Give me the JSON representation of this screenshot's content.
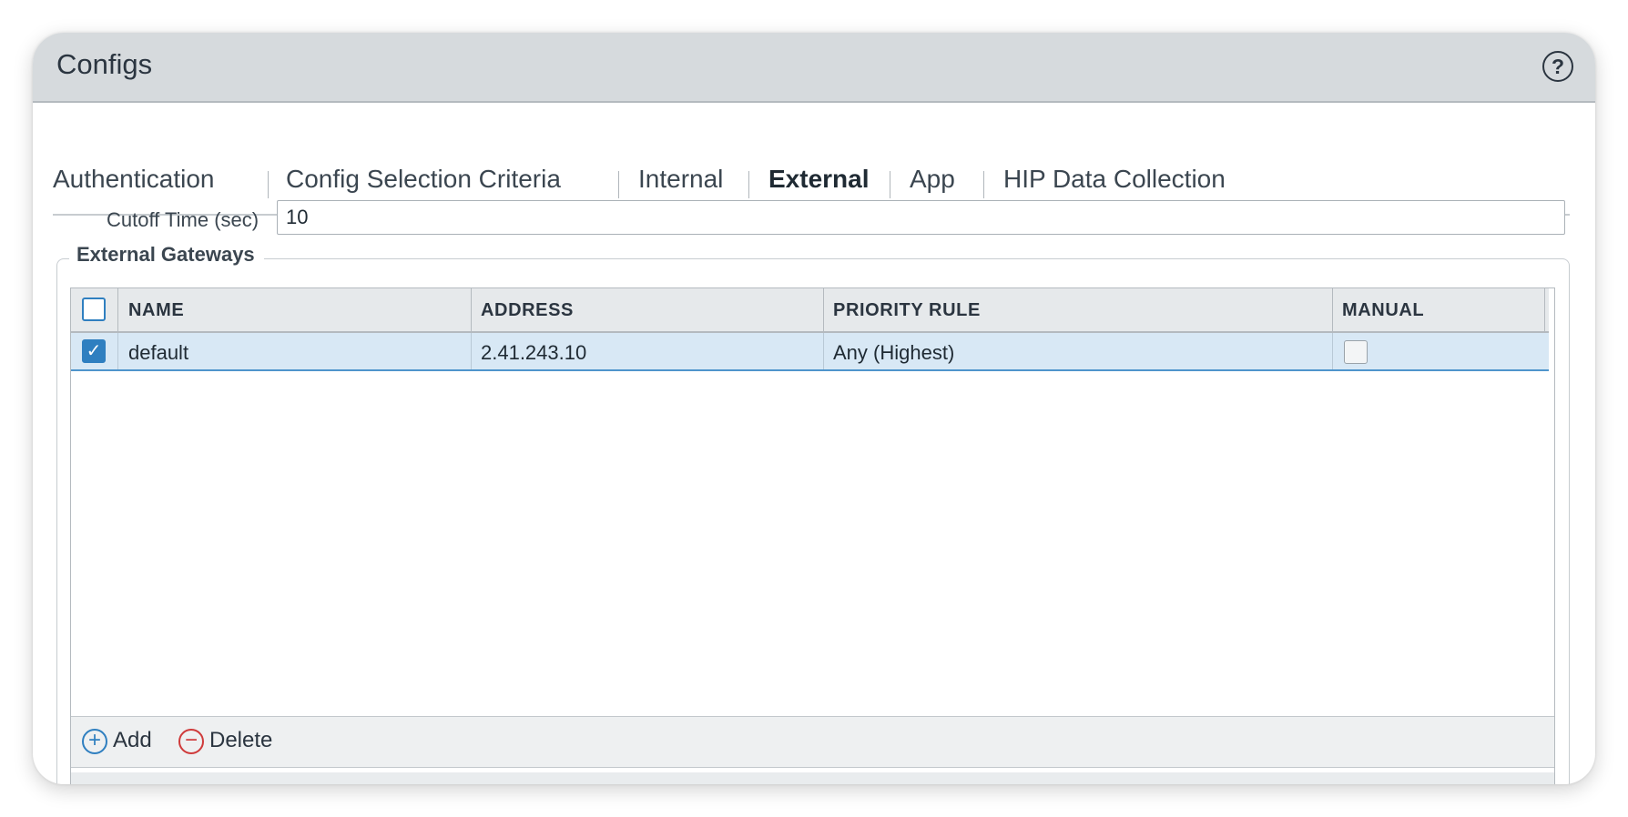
{
  "window": {
    "title": "Configs"
  },
  "tabs": [
    {
      "label": "Authentication",
      "active": false
    },
    {
      "label": "Config Selection Criteria",
      "active": false
    },
    {
      "label": "Internal",
      "active": false
    },
    {
      "label": "External",
      "active": true
    },
    {
      "label": "App",
      "active": false
    },
    {
      "label": "HIP Data Collection",
      "active": false
    }
  ],
  "cutoff": {
    "label": "Cutoff Time (sec)",
    "value": "10"
  },
  "gateways": {
    "legend": "External Gateways",
    "columns": [
      "NAME",
      "ADDRESS",
      "PRIORITY RULE",
      "MANUAL"
    ],
    "rows": [
      {
        "selected": true,
        "name": "default",
        "address": "2.41.243.10",
        "priority_rule": "Any (Highest)",
        "manual": false
      }
    ],
    "actions": {
      "add_label": "Add",
      "delete_label": "Delete"
    }
  },
  "colors": {
    "accent": "#1f7ec6",
    "delete": "#cf3a3a",
    "header_bg": "#d6dadd",
    "row_selected": "#d8e8f5"
  }
}
